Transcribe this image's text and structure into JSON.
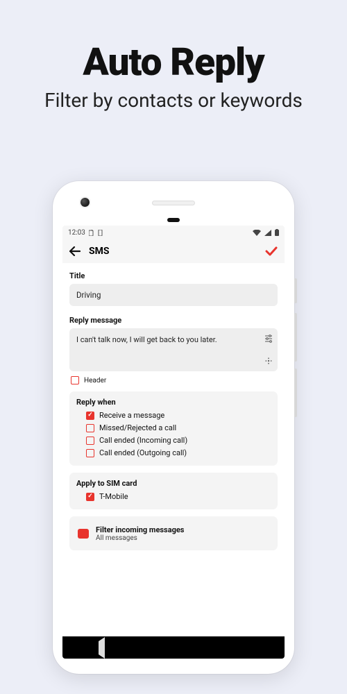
{
  "hero": {
    "title": "Auto Reply",
    "subtitle": "Filter by contacts or keywords"
  },
  "statusbar": {
    "time": "12:03"
  },
  "appbar": {
    "title": "SMS"
  },
  "title_section": {
    "label": "Title",
    "value": "Driving"
  },
  "reply_section": {
    "label": "Reply message",
    "value": "I can't talk now, I will get back to you later."
  },
  "header_checkbox": {
    "label": "Header",
    "checked": false
  },
  "reply_when": {
    "label": "Reply when",
    "items": [
      {
        "label": "Receive a message",
        "checked": true
      },
      {
        "label": "Missed/Rejected a call",
        "checked": false
      },
      {
        "label": "Call ended (Incoming call)",
        "checked": false
      },
      {
        "label": "Call ended (Outgoing call)",
        "checked": false
      }
    ]
  },
  "sim_card": {
    "label": "Apply to SIM card",
    "items": [
      {
        "label": "T-Mobile",
        "checked": true
      }
    ]
  },
  "filter": {
    "title": "Filter incoming messages",
    "subtitle": "All messages"
  }
}
